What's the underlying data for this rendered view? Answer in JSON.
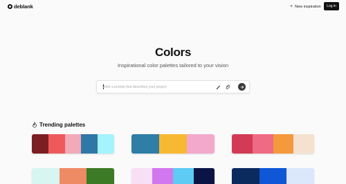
{
  "header": {
    "logo_text": "deblank",
    "new_inspiration_label": "New inspiration",
    "login_label": "Log in"
  },
  "hero": {
    "title": "Colors",
    "subtitle": "Inspirational color palettes tailored to your vision"
  },
  "prompt": {
    "placeholder": "Write a prompt that describes your project"
  },
  "trending": {
    "title": "Trending palettes",
    "palettes": [
      {
        "colors": [
          "#7b1f24",
          "#ee5a5a",
          "#f2a9b8",
          "#2f77a6",
          "#a5f3fd"
        ]
      },
      {
        "colors": [
          "#2f7ea8",
          "#f8b932",
          "#f2a9cc"
        ]
      },
      {
        "colors": [
          "#d23a55",
          "#ee6a85",
          "#f39a3c",
          "#f5e1cf"
        ]
      },
      {
        "colors": [
          "#d8f6f1",
          "#ee8a64",
          "#3d7a25"
        ]
      },
      {
        "colors": [
          "#f7e0f5",
          "#d377ee",
          "#5dcbf3",
          "#0a1545"
        ]
      },
      {
        "colors": [
          "#0b2a5e",
          "#0f57d6",
          "#dbe7fb"
        ]
      }
    ]
  }
}
